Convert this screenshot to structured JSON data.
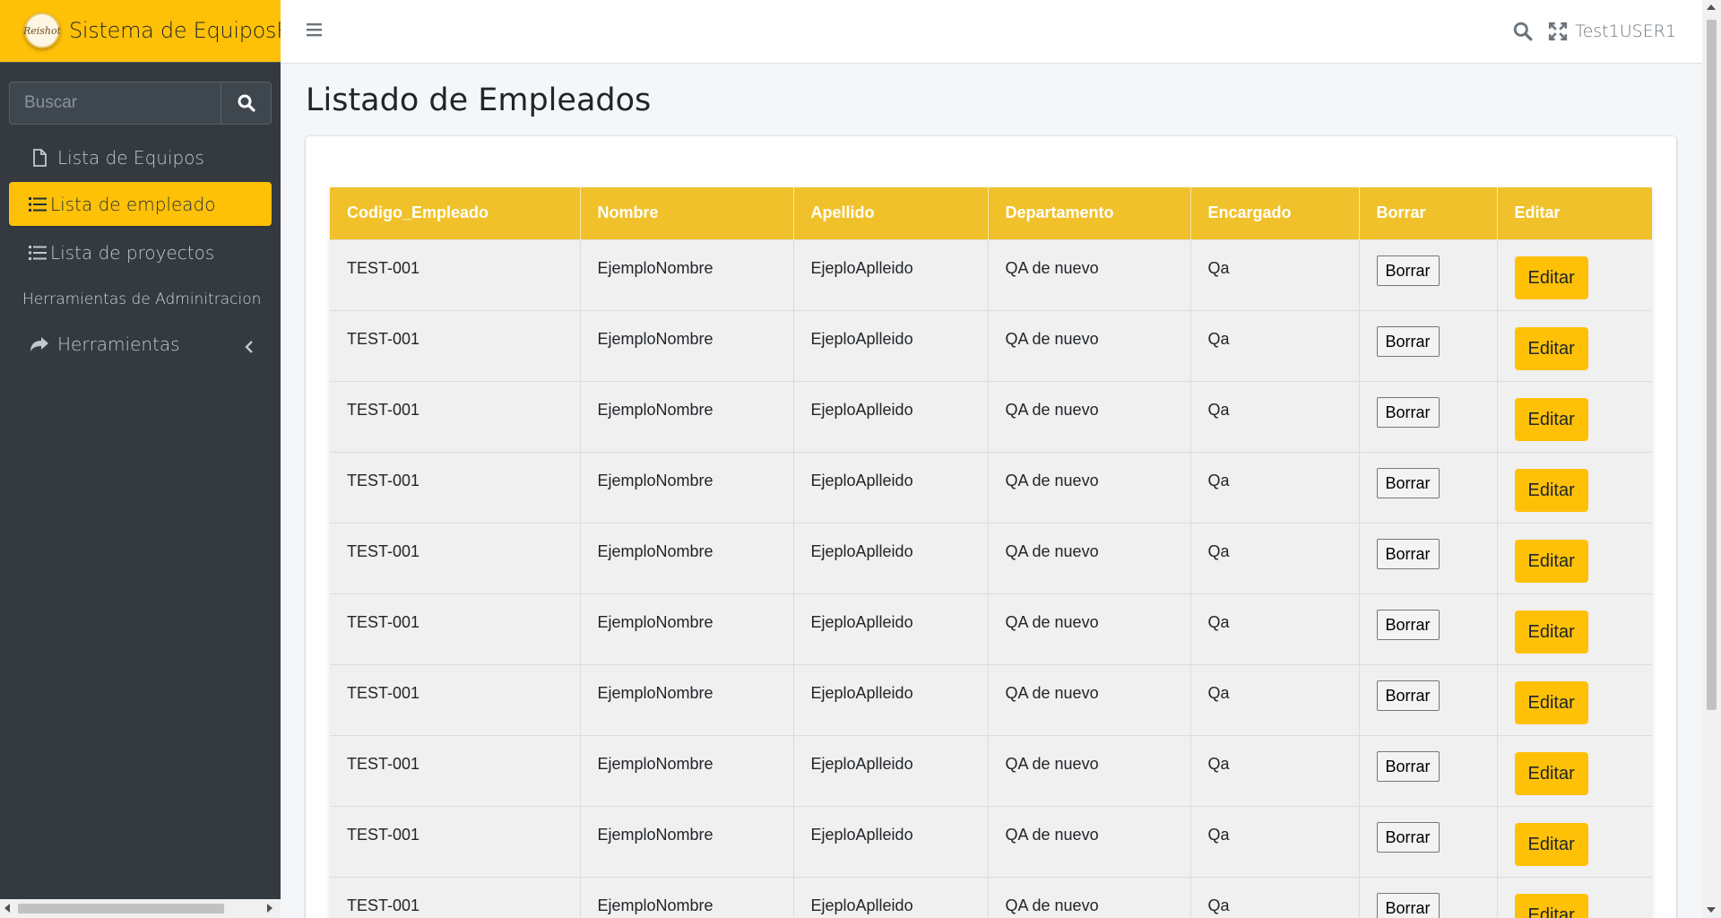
{
  "brand": {
    "logo_text": "Reishot",
    "title": "Sistema de EquiposRe"
  },
  "sidebar": {
    "search_placeholder": "Buscar",
    "items": [
      {
        "label": "Lista de Equipos",
        "icon": "file-icon"
      },
      {
        "label": "Lista de empleado",
        "icon": "list-icon",
        "active": true
      },
      {
        "label": "Lista de proyectos",
        "icon": "list-icon"
      }
    ],
    "section_header": "Herramientas de Adminitracion",
    "tools_label": "Herramientas"
  },
  "topbar": {
    "username": "Test1USER1"
  },
  "page": {
    "title": "Listado de Empleados"
  },
  "table": {
    "headers": [
      "Codigo_Empleado",
      "Nombre",
      "Apellido",
      "Departamento",
      "Encargado",
      "Borrar",
      "Editar"
    ],
    "rows": [
      [
        "TEST-001",
        "EjemploNombre",
        "EjeploAplleido",
        "QA de nuevo",
        "Qa",
        "Borrar",
        "Editar"
      ],
      [
        "TEST-001",
        "EjemploNombre",
        "EjeploAplleido",
        "QA de nuevo",
        "Qa",
        "Borrar",
        "Editar"
      ],
      [
        "TEST-001",
        "EjemploNombre",
        "EjeploAplleido",
        "QA de nuevo",
        "Qa",
        "Borrar",
        "Editar"
      ],
      [
        "TEST-001",
        "EjemploNombre",
        "EjeploAplleido",
        "QA de nuevo",
        "Qa",
        "Borrar",
        "Editar"
      ],
      [
        "TEST-001",
        "EjemploNombre",
        "EjeploAplleido",
        "QA de nuevo",
        "Qa",
        "Borrar",
        "Editar"
      ],
      [
        "TEST-001",
        "EjemploNombre",
        "EjeploAplleido",
        "QA de nuevo",
        "Qa",
        "Borrar",
        "Editar"
      ],
      [
        "TEST-001",
        "EjemploNombre",
        "EjeploAplleido",
        "QA de nuevo",
        "Qa",
        "Borrar",
        "Editar"
      ],
      [
        "TEST-001",
        "EjemploNombre",
        "EjeploAplleido",
        "QA de nuevo",
        "Qa",
        "Borrar",
        "Editar"
      ],
      [
        "TEST-001",
        "EjemploNombre",
        "EjeploAplleido",
        "QA de nuevo",
        "Qa",
        "Borrar",
        "Editar"
      ],
      [
        "TEST-001",
        "EjemploNombre",
        "EjeploAplleido",
        "QA de nuevo",
        "Qa",
        "Borrar",
        "Editar"
      ]
    ]
  },
  "colors": {
    "accent": "#ffc107",
    "sidebar_bg": "#343a40",
    "table_header": "#f0c12a"
  }
}
